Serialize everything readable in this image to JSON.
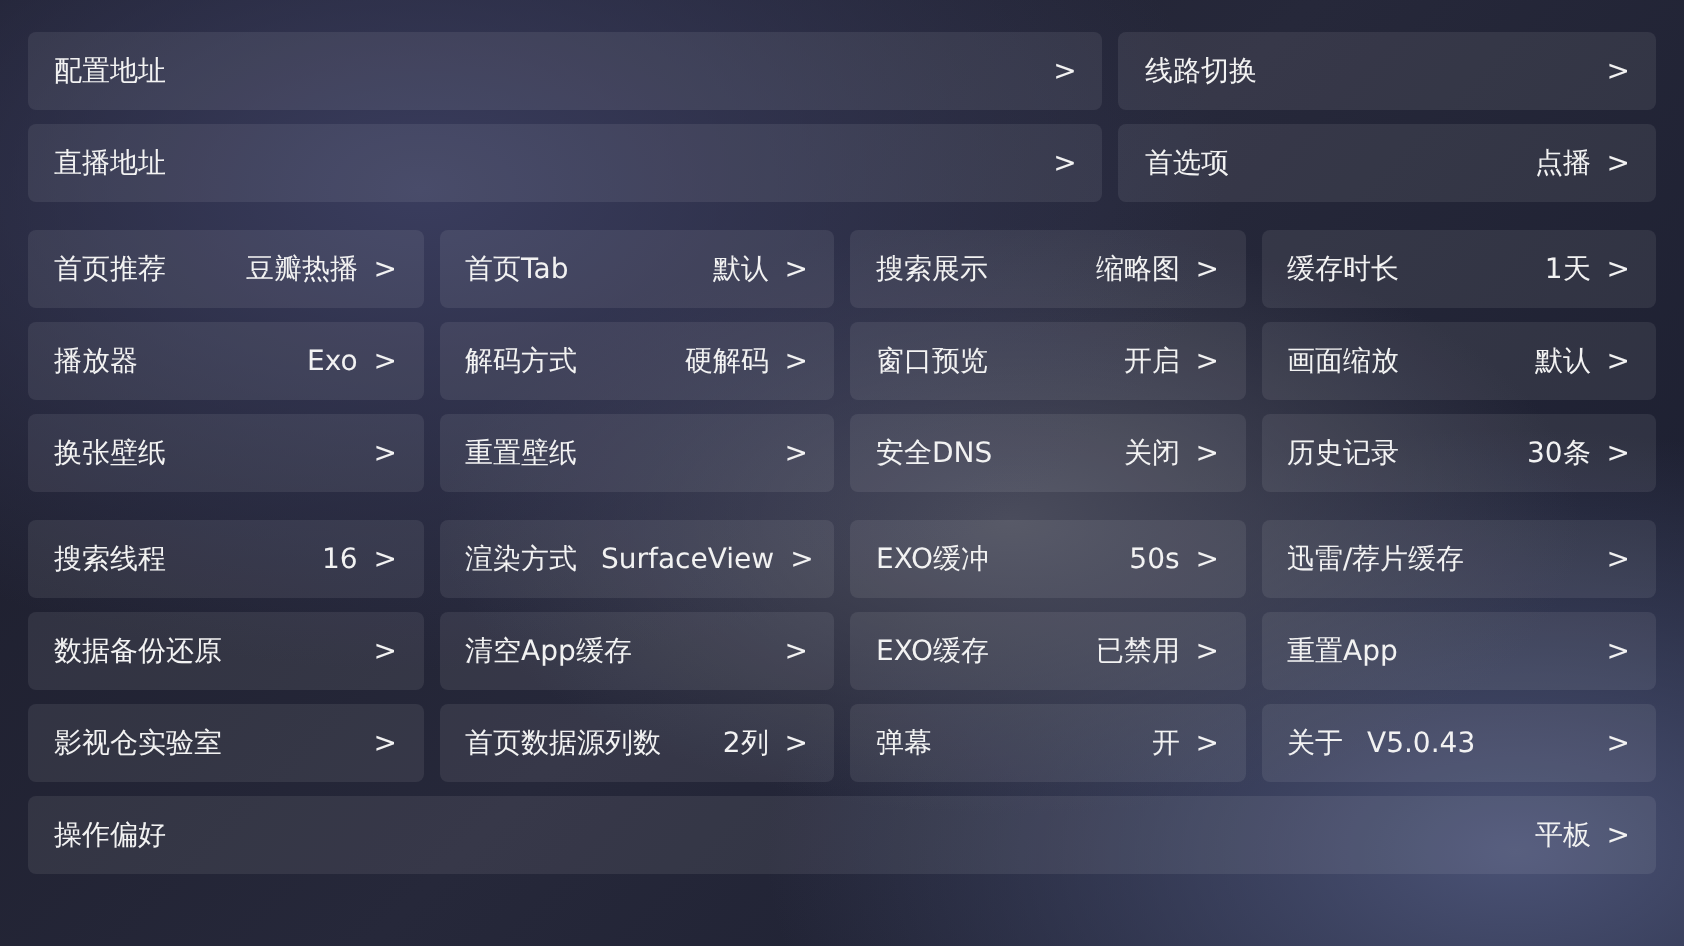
{
  "sections": [
    {
      "kind": "pair",
      "items": [
        {
          "label": "配置地址",
          "chevron": ">"
        },
        {
          "label": "线路切换",
          "chevron": ">"
        },
        {
          "label": "直播地址",
          "chevron": ">"
        },
        {
          "label": "首选项",
          "value": "点播",
          "chevron": ">"
        }
      ]
    },
    {
      "kind": "grid",
      "items": [
        {
          "label": "首页推荐",
          "value": "豆瓣热播",
          "chevron": ">"
        },
        {
          "label": "首页Tab",
          "value": "默认",
          "chevron": ">"
        },
        {
          "label": "搜索展示",
          "value": "缩略图",
          "chevron": ">"
        },
        {
          "label": "缓存时长",
          "value": "1天",
          "chevron": ">"
        },
        {
          "label": "播放器",
          "value": "Exo",
          "chevron": ">"
        },
        {
          "label": "解码方式",
          "value": "硬解码",
          "chevron": ">"
        },
        {
          "label": "窗口预览",
          "value": "开启",
          "chevron": ">"
        },
        {
          "label": "画面缩放",
          "value": "默认",
          "chevron": ">"
        },
        {
          "label": "换张壁纸",
          "chevron": ">"
        },
        {
          "label": "重置壁纸",
          "chevron": ">"
        },
        {
          "label": "安全DNS",
          "value": "关闭",
          "chevron": ">"
        },
        {
          "label": "历史记录",
          "value": "30条",
          "chevron": ">"
        }
      ]
    },
    {
      "kind": "grid",
      "items": [
        {
          "label": "搜索线程",
          "value": "16",
          "chevron": ">"
        },
        {
          "label": "渲染方式",
          "value": "SurfaceView",
          "chevron": ">"
        },
        {
          "label": "EXO缓冲",
          "value": "50s",
          "chevron": ">"
        },
        {
          "label": "迅雷/荐片缓存",
          "chevron": ">"
        },
        {
          "label": "数据备份还原",
          "chevron": ">"
        },
        {
          "label": "清空App缓存",
          "chevron": ">"
        },
        {
          "label": "EXO缓存",
          "value": "已禁用",
          "chevron": ">"
        },
        {
          "label": "重置App",
          "chevron": ">"
        },
        {
          "label": "影视仓实验室",
          "chevron": ">"
        },
        {
          "label": "首页数据源列数",
          "value": "2列",
          "chevron": ">"
        },
        {
          "label": "弹幕",
          "value": "开",
          "chevron": ">"
        },
        {
          "label": "关于",
          "detail": "V5.0.43",
          "chevron": ">"
        },
        {
          "label": "操作偏好",
          "value": "平板",
          "chevron": ">",
          "wide": true
        }
      ]
    }
  ]
}
